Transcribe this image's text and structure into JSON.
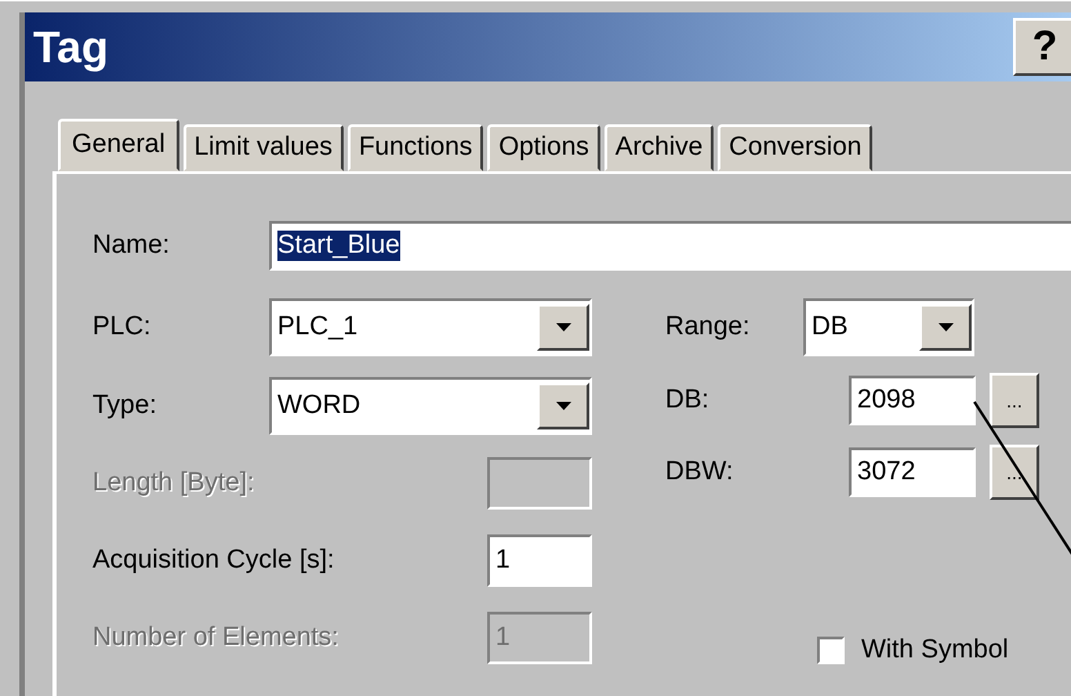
{
  "window": {
    "title": "Tag",
    "help_button": "?"
  },
  "tabs": [
    {
      "label": "General",
      "selected": true
    },
    {
      "label": "Limit values",
      "selected": false
    },
    {
      "label": "Functions",
      "selected": false
    },
    {
      "label": "Options",
      "selected": false
    },
    {
      "label": "Archive",
      "selected": false
    },
    {
      "label": "Conversion",
      "selected": false
    }
  ],
  "name_field": {
    "label": "Name:",
    "value": "Start_Blue",
    "value_selected": true
  },
  "left_fields": [
    {
      "kind": "dropdown",
      "label": "PLC:",
      "value": "PLC_1"
    },
    {
      "kind": "dropdown",
      "label": "Type:",
      "value": "WORD"
    },
    {
      "kind": "text",
      "label": "Length [Byte]:",
      "disabled": true
    },
    {
      "kind": "text",
      "label": "Acquisition Cycle [s]:",
      "value": "1",
      "disabled": false
    },
    {
      "kind": "text",
      "label": "Number of Elements:",
      "value": "1",
      "disabled": true
    }
  ],
  "right_fields": [
    {
      "kind": "dropdown",
      "label": "Range:",
      "value": "DB"
    },
    {
      "kind": "browse",
      "label": "DB:",
      "value": "2098",
      "button": "..."
    },
    {
      "kind": "browse",
      "label": "DBW:",
      "value": "3072",
      "button": "..."
    }
  ],
  "checkbox": {
    "label": "With Symbol",
    "checked": false
  }
}
